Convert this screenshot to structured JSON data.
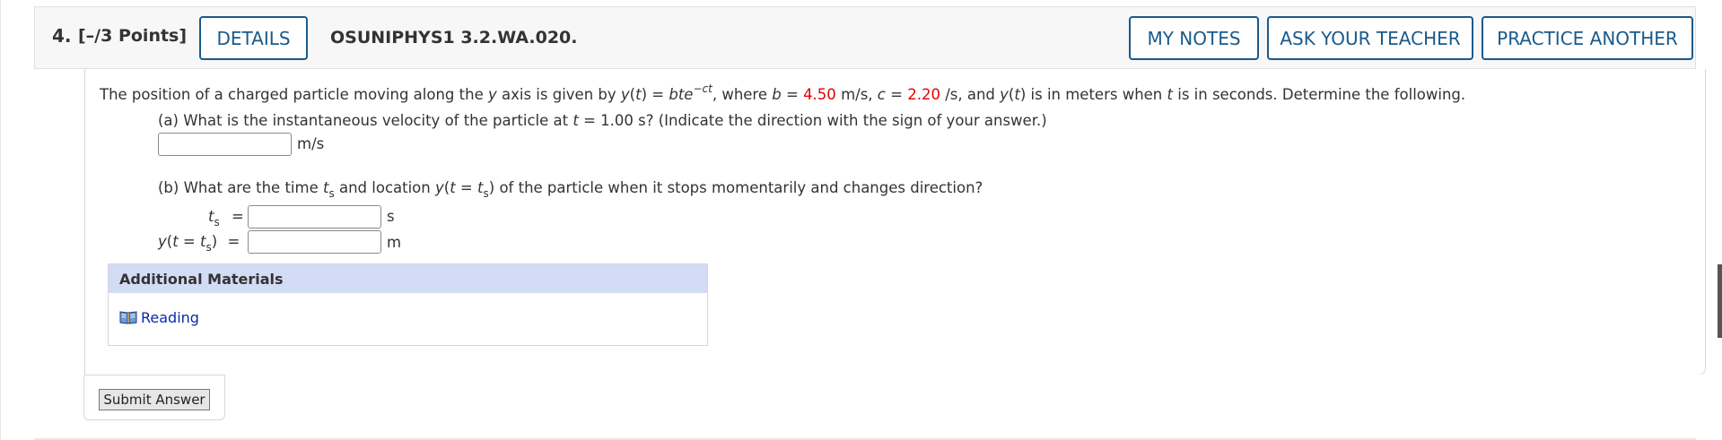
{
  "question": {
    "number": "4.",
    "points": "[–/3 Points]",
    "code": "OSUNIPHYS1 3.2.WA.020.",
    "buttons": {
      "details": "DETAILS",
      "my_notes": "MY NOTES",
      "ask_teacher": "ASK YOUR TEACHER",
      "practice_another": "PRACTICE ANOTHER"
    }
  },
  "prompt": {
    "intro": "The position of a charged particle moving along the",
    "axis_var": "y",
    "axis_word": "axis is given by",
    "func_name": "y",
    "func_arg": "t",
    "eq": " = ",
    "expr_base": "bte",
    "expr_exp": "−ct",
    "where": ", where",
    "b_var": "b",
    "b_value": "4.50",
    "b_unit": "m/s,",
    "c_var": "c",
    "c_value": "2.20",
    "c_unit": "/s, and",
    "meters_clause": "is in meters when",
    "t_var": "t",
    "tail": "is in seconds. Determine the following."
  },
  "part_a": {
    "q_start": "(a) What is the instantaneous velocity of the particle at",
    "t_var": "t",
    "q_value": " = 1.00 s? (Indicate the direction with the sign of your answer.)",
    "answer_value": "",
    "unit": "m/s"
  },
  "part_b": {
    "q_start": "(b) What are the time",
    "t_var": "t",
    "t_sub": "s",
    "q_mid": "and location",
    "y_var": "y",
    "q_end": "of the particle when it stops momentarily and changes direction?",
    "ts_label_var": "t",
    "ts_label_sub": "s",
    "ts_eq": "=",
    "ts_value": "",
    "ts_unit": "s",
    "y_eq": "=",
    "y_value": "",
    "y_unit": "m"
  },
  "additional_materials": {
    "title": "Additional Materials",
    "reading_label": "Reading",
    "icon": "book-icon"
  },
  "submit_label": "Submit Answer",
  "colors": {
    "accent": "#1a5a8a",
    "given_value": "#e10000",
    "link": "#0a2aa8",
    "materials_header": "#d3dcf5"
  }
}
